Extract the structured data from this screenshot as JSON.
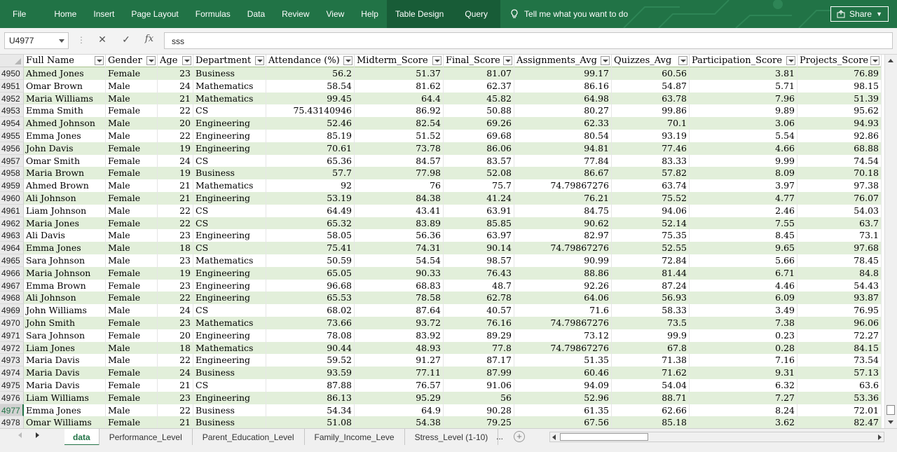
{
  "ribbon": {
    "tabs": [
      "File",
      "Home",
      "Insert",
      "Page Layout",
      "Formulas",
      "Data",
      "Review",
      "View",
      "Help"
    ],
    "context_tabs": [
      "Table Design",
      "Query"
    ],
    "tell_me": "Tell me what you want to do",
    "share": "Share",
    "accent": "#217346"
  },
  "formula_bar": {
    "name_box": "U4977",
    "cancel": "✕",
    "enter": "✓",
    "fx": "fx",
    "value": "sss"
  },
  "columns": [
    "Full Name",
    "Gender",
    "Age",
    "Department",
    "Attendance (%)",
    "Midterm_Score",
    "Final_Score",
    "Assignments_Avg",
    "Quizzes_Avg",
    "Participation_Score",
    "Projects_Score"
  ],
  "selected_row": "4977",
  "rows": [
    [
      "4950",
      "Ahmed Jones",
      "Female",
      "23",
      "Business",
      "56.2",
      "51.37",
      "81.07",
      "99.17",
      "60.56",
      "3.81",
      "76.89"
    ],
    [
      "4951",
      "Omar Brown",
      "Male",
      "24",
      "Mathematics",
      "58.54",
      "81.62",
      "62.37",
      "86.16",
      "54.87",
      "5.71",
      "98.15"
    ],
    [
      "4952",
      "Maria Williams",
      "Male",
      "21",
      "Mathematics",
      "99.45",
      "64.4",
      "45.82",
      "64.98",
      "63.78",
      "7.96",
      "51.39"
    ],
    [
      "4953",
      "Emma Smith",
      "Female",
      "22",
      "CS",
      "75.43140946",
      "86.92",
      "50.88",
      "80.27",
      "99.86",
      "9.89",
      "95.62"
    ],
    [
      "4954",
      "Ahmed Johnson",
      "Male",
      "20",
      "Engineering",
      "52.46",
      "82.54",
      "69.26",
      "62.33",
      "70.1",
      "3.06",
      "94.93"
    ],
    [
      "4955",
      "Emma Jones",
      "Male",
      "22",
      "Engineering",
      "85.19",
      "51.52",
      "69.68",
      "80.54",
      "93.19",
      "5.54",
      "92.86"
    ],
    [
      "4956",
      "John Davis",
      "Female",
      "19",
      "Engineering",
      "70.61",
      "73.78",
      "86.06",
      "94.81",
      "77.46",
      "4.66",
      "68.88"
    ],
    [
      "4957",
      "Omar Smith",
      "Female",
      "24",
      "CS",
      "65.36",
      "84.57",
      "83.57",
      "77.84",
      "83.33",
      "9.99",
      "74.54"
    ],
    [
      "4958",
      "Maria Brown",
      "Female",
      "19",
      "Business",
      "57.7",
      "77.98",
      "52.08",
      "86.67",
      "57.82",
      "8.09",
      "70.18"
    ],
    [
      "4959",
      "Ahmed Brown",
      "Male",
      "21",
      "Mathematics",
      "92",
      "76",
      "75.7",
      "74.79867276",
      "63.74",
      "3.97",
      "97.38"
    ],
    [
      "4960",
      "Ali Johnson",
      "Female",
      "21",
      "Engineering",
      "53.19",
      "84.38",
      "41.24",
      "76.21",
      "75.52",
      "4.77",
      "76.07"
    ],
    [
      "4961",
      "Liam Johnson",
      "Male",
      "22",
      "CS",
      "64.49",
      "43.41",
      "63.91",
      "84.75",
      "94.06",
      "2.46",
      "54.03"
    ],
    [
      "4962",
      "Maria Jones",
      "Female",
      "22",
      "CS",
      "65.32",
      "83.89",
      "85.85",
      "90.62",
      "52.14",
      "7.55",
      "63.7"
    ],
    [
      "4963",
      "Ali Davis",
      "Male",
      "23",
      "Engineering",
      "58.05",
      "56.36",
      "63.97",
      "82.97",
      "75.35",
      "8.45",
      "73.1"
    ],
    [
      "4964",
      "Emma Jones",
      "Male",
      "18",
      "CS",
      "75.41",
      "74.31",
      "90.14",
      "74.79867276",
      "52.55",
      "9.65",
      "97.68"
    ],
    [
      "4965",
      "Sara Johnson",
      "Male",
      "23",
      "Mathematics",
      "50.59",
      "54.54",
      "98.57",
      "90.99",
      "72.84",
      "5.66",
      "78.45"
    ],
    [
      "4966",
      "Maria Johnson",
      "Female",
      "19",
      "Engineering",
      "65.05",
      "90.33",
      "76.43",
      "88.86",
      "81.44",
      "6.71",
      "84.8"
    ],
    [
      "4967",
      "Emma Brown",
      "Female",
      "23",
      "Engineering",
      "96.68",
      "68.83",
      "48.7",
      "92.26",
      "87.24",
      "4.46",
      "54.43"
    ],
    [
      "4968",
      "Ali Johnson",
      "Female",
      "22",
      "Engineering",
      "65.53",
      "78.58",
      "62.78",
      "64.06",
      "56.93",
      "6.09",
      "93.87"
    ],
    [
      "4969",
      "John Williams",
      "Male",
      "24",
      "CS",
      "68.02",
      "87.64",
      "40.57",
      "71.6",
      "58.33",
      "3.49",
      "76.95"
    ],
    [
      "4970",
      "John Smith",
      "Female",
      "23",
      "Mathematics",
      "73.66",
      "93.72",
      "76.16",
      "74.79867276",
      "73.5",
      "7.38",
      "96.06"
    ],
    [
      "4971",
      "Sara Johnson",
      "Female",
      "20",
      "Engineering",
      "78.08",
      "83.92",
      "89.29",
      "73.12",
      "99.9",
      "0.23",
      "72.27"
    ],
    [
      "4972",
      "Liam Jones",
      "Male",
      "18",
      "Mathematics",
      "90.44",
      "48.93",
      "77.8",
      "74.79867276",
      "67.8",
      "0.28",
      "84.15"
    ],
    [
      "4973",
      "Maria Davis",
      "Male",
      "22",
      "Engineering",
      "59.52",
      "91.27",
      "87.17",
      "51.35",
      "71.38",
      "7.16",
      "73.54"
    ],
    [
      "4974",
      "Maria Davis",
      "Female",
      "24",
      "Business",
      "93.59",
      "77.11",
      "87.99",
      "60.46",
      "71.62",
      "9.31",
      "57.13"
    ],
    [
      "4975",
      "Maria Davis",
      "Female",
      "21",
      "CS",
      "87.88",
      "76.57",
      "91.06",
      "94.09",
      "54.04",
      "6.32",
      "63.6"
    ],
    [
      "4976",
      "Liam Williams",
      "Female",
      "23",
      "Engineering",
      "86.13",
      "95.29",
      "56",
      "52.96",
      "88.71",
      "7.27",
      "53.36"
    ],
    [
      "4977",
      "Emma Jones",
      "Male",
      "22",
      "Business",
      "54.34",
      "64.9",
      "90.28",
      "61.35",
      "62.66",
      "8.24",
      "72.01"
    ],
    [
      "4978",
      "Omar Williams",
      "Female",
      "21",
      "Business",
      "51.08",
      "54.38",
      "79.25",
      "67.56",
      "85.18",
      "3.62",
      "82.47"
    ]
  ],
  "sheet_tabs": [
    "data",
    "Performance_Level",
    "Parent_Education_Level",
    "Family_Income_Leve",
    "Stress_Level (1-10)"
  ],
  "active_sheet": "data",
  "sheet_more": "...",
  "add_sheet": "+"
}
